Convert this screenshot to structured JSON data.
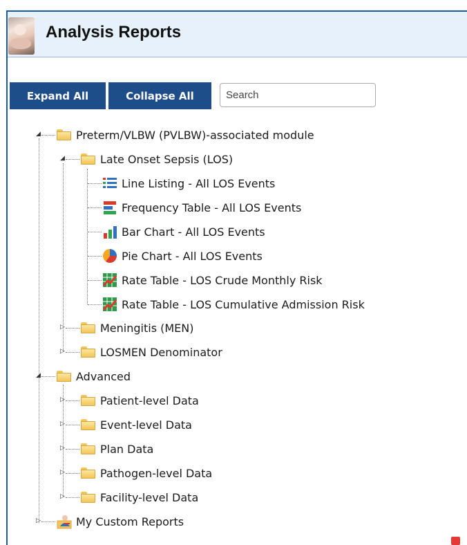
{
  "header": {
    "title": "Analysis Reports",
    "logo_icon": "nurse-baby-photo"
  },
  "toolbar": {
    "expand_all_label": "Expand All",
    "collapse_all_label": "Collapse All",
    "search_placeholder": "Search",
    "search_value": ""
  },
  "colors": {
    "button_bg": "#1d4e89",
    "header_bg": "#e7f1fb",
    "frame_border": "#1d5aa6"
  },
  "tree": {
    "pvlbw": {
      "label": "Preterm/VLBW (PVLBW)-associated module",
      "expanded": true,
      "los": {
        "label": "Late Onset Sepsis (LOS)",
        "expanded": true,
        "reports": [
          {
            "label": "Line Listing - All LOS Events",
            "icon": "line-listing-icon"
          },
          {
            "label": "Frequency Table - All LOS Events",
            "icon": "frequency-table-icon"
          },
          {
            "label": "Bar Chart - All LOS Events",
            "icon": "bar-chart-icon"
          },
          {
            "label": "Pie Chart - All LOS Events",
            "icon": "pie-chart-icon"
          },
          {
            "label": "Rate Table - LOS Crude Monthly Risk",
            "icon": "rate-table-icon"
          },
          {
            "label": "Rate Table - LOS Cumulative Admission Risk",
            "icon": "rate-table-icon"
          }
        ]
      },
      "men": {
        "label": "Meningitis (MEN)",
        "expanded": false
      },
      "losmen": {
        "label": "LOSMEN Denominator",
        "expanded": false
      }
    },
    "advanced": {
      "label": "Advanced",
      "expanded": true,
      "children": [
        {
          "label": "Patient-level Data"
        },
        {
          "label": "Event-level Data"
        },
        {
          "label": "Plan Data"
        },
        {
          "label": "Pathogen-level Data"
        },
        {
          "label": "Facility-level Data"
        }
      ]
    },
    "custom": {
      "label": "My Custom Reports",
      "expanded": false,
      "icon": "custom-report-person-icon"
    }
  }
}
